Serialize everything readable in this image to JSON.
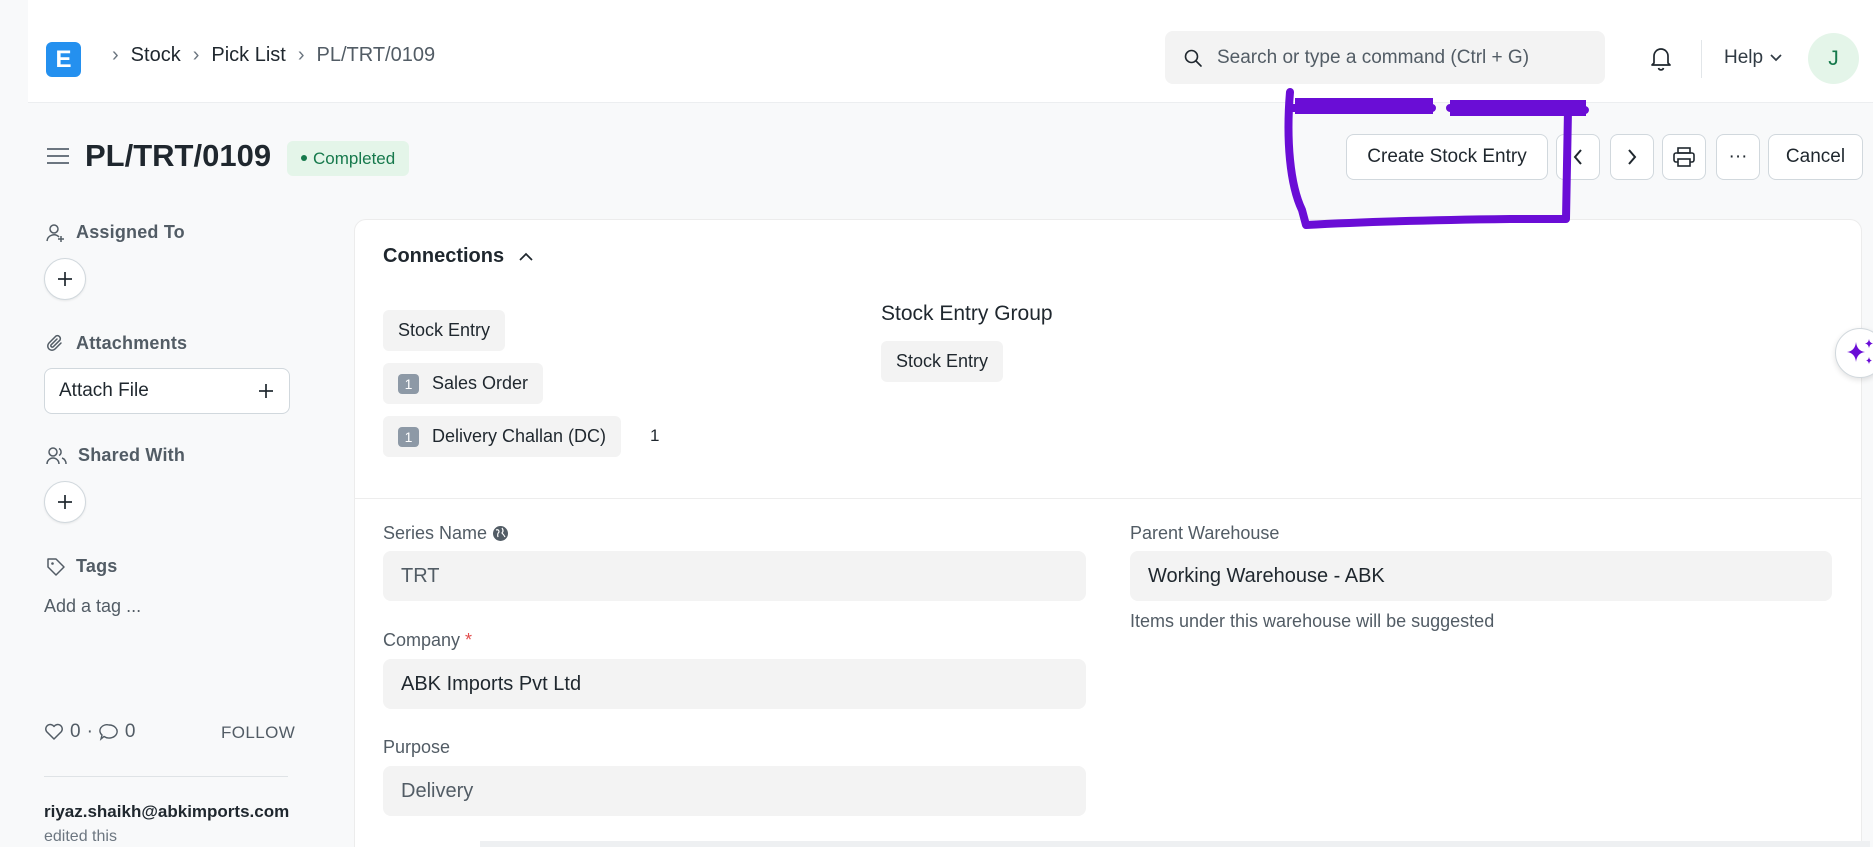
{
  "navbar": {
    "logo_letter": "E",
    "breadcrumbs": [
      "Stock",
      "Pick List",
      "PL/TRT/0109"
    ],
    "search_placeholder": "Search or type a command (Ctrl + G)",
    "help_label": "Help",
    "avatar_initial": "J"
  },
  "page": {
    "title": "PL/TRT/0109",
    "status": "Completed",
    "actions": {
      "create_stock_entry": "Create Stock Entry",
      "more": "···",
      "cancel": "Cancel"
    }
  },
  "sidebar": {
    "assigned_to": "Assigned To",
    "attachments": "Attachments",
    "attach_file": "Attach File",
    "shared_with": "Shared With",
    "tags": "Tags",
    "add_tag": "Add a tag ...",
    "likes": "0",
    "comments": "0",
    "stat_sep": "·",
    "follow": "FOLLOW",
    "editor_email": "riyaz.shaikh@abkimports.com",
    "editor_action": "edited this"
  },
  "connections": {
    "title": "Connections",
    "left": [
      {
        "label": "Stock Entry",
        "count": null
      },
      {
        "label": "Sales Order",
        "count": "1"
      },
      {
        "label": "Delivery Challan (DC)",
        "count": "1"
      }
    ],
    "dc_total": "1",
    "group_title": "Stock Entry Group",
    "group_items": [
      "Stock Entry"
    ]
  },
  "form": {
    "series_name_label": "Series Name",
    "series_name_value": "TRT",
    "company_label": "Company",
    "company_required": "*",
    "company_value": "ABK Imports Pvt Ltd",
    "purpose_label": "Purpose",
    "purpose_value": "Delivery",
    "parent_warehouse_label": "Parent Warehouse",
    "parent_warehouse_value": "Working Warehouse - ABK",
    "parent_warehouse_hint": "Items under this warehouse will be suggested"
  },
  "colors": {
    "brand": "#2490ef",
    "status_bg": "#e4f5e9",
    "status_text": "#16794c",
    "annotation": "#6a0dd6"
  }
}
